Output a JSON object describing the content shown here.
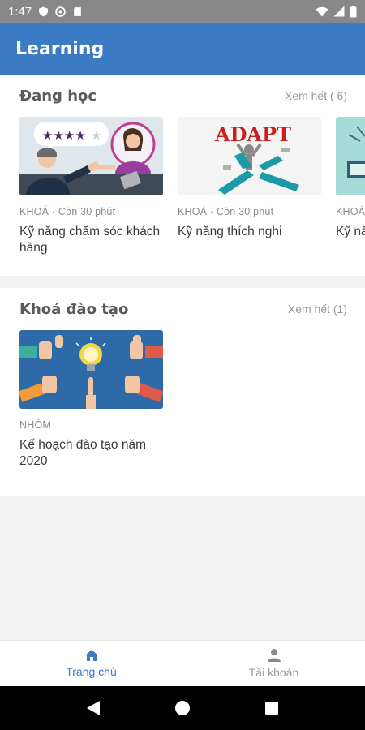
{
  "status_bar": {
    "time": "1:47"
  },
  "app_bar": {
    "title": "Learning"
  },
  "sections": [
    {
      "title": "Đang học",
      "see_all": "Xem hết ( 6)",
      "cards": [
        {
          "meta": "KHOÁ · Còn 30 phút",
          "title": "Kỹ năng chăm sóc khách hàng",
          "image": "customer-care-image"
        },
        {
          "meta": "KHOÁ · Còn 30 phút",
          "title": "Kỹ năng thích nghi",
          "image": "adapt-image",
          "image_text": "ADAPT"
        },
        {
          "meta": "KHOÁ",
          "title": "Kỹ nă gian",
          "image": "time-image"
        }
      ]
    },
    {
      "title": "Khoá đào tạo",
      "see_all": "Xem hết (1)",
      "cards": [
        {
          "meta": "NHÓM",
          "title": "Kế hoạch đào tạo năm 2020",
          "image": "thumbs-up-idea-image"
        }
      ]
    }
  ],
  "bottom_nav": {
    "items": [
      {
        "label": "Trang chủ",
        "icon": "home-icon",
        "active": true
      },
      {
        "label": "Tài khoản",
        "icon": "person-icon",
        "active": false
      }
    ]
  },
  "colors": {
    "primary": "#3b7bc4",
    "status_bar": "#888888",
    "section_title": "#5a5a5a",
    "muted": "#9a9a9a"
  }
}
